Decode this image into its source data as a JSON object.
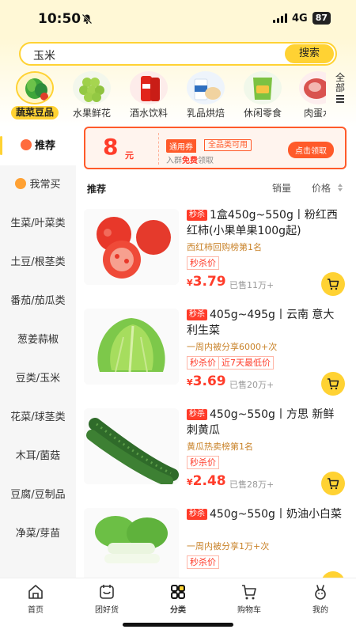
{
  "status": {
    "time": "10:50",
    "network": "4G",
    "battery": "87"
  },
  "search": {
    "query": "玉米",
    "button_label": "搜索"
  },
  "categories": [
    {
      "label": "蔬菜豆品",
      "active": true
    },
    {
      "label": "水果鲜花"
    },
    {
      "label": "酒水饮料"
    },
    {
      "label": "乳品烘焙"
    },
    {
      "label": "休闲零食"
    },
    {
      "label": "肉蛋水"
    }
  ],
  "all_button": {
    "line1": "全",
    "line2": "部"
  },
  "sidebar": [
    {
      "label": "推荐",
      "active": true
    },
    {
      "label": "我常买"
    },
    {
      "label": "生菜/叶菜类"
    },
    {
      "label": "土豆/根茎类"
    },
    {
      "label": "番茄/茄瓜类"
    },
    {
      "label": "葱姜蒜椒"
    },
    {
      "label": "豆类/玉米"
    },
    {
      "label": "花菜/球茎类"
    },
    {
      "label": "木耳/菌菇"
    },
    {
      "label": "豆腐/豆制品"
    },
    {
      "label": "净菜/芽苗"
    }
  ],
  "coupon": {
    "amount": "8",
    "unit": "元",
    "tag_type": "通用券",
    "tag_scope": "全品类可用",
    "sub_prefix": "入群",
    "sub_free": "免费",
    "sub_suffix": "领取",
    "button": "点击领取"
  },
  "sort": {
    "title": "推荐",
    "sales": "销量",
    "price": "价格"
  },
  "products": [
    {
      "badge": "秒杀",
      "title": "1盒450g~550g丨粉红西红柿(小果单果100g起)",
      "rank": "西红柿回购榜第1名",
      "tags": [
        "秒杀价"
      ],
      "yen": "¥",
      "price": "3.79",
      "sold": "已售11万+"
    },
    {
      "badge": "秒杀",
      "title": "405g~495g丨云南 意大利生菜",
      "rank": "一周内被分享6000+次",
      "tags": [
        "秒杀价",
        "近7天最低价"
      ],
      "yen": "¥",
      "price": "3.69",
      "sold": "已售20万+"
    },
    {
      "badge": "秒杀",
      "title": "450g~550g丨方思 新鲜刺黄瓜",
      "rank": "黄瓜热卖榜第1名",
      "tags": [
        "秒杀价"
      ],
      "yen": "¥",
      "price": "2.48",
      "sold": "已售28万+"
    },
    {
      "badge": "秒杀",
      "title": "450g~550g丨奶油小白菜",
      "rank": "一周内被分享1万+次",
      "tags": [
        "秒杀价"
      ]
    }
  ],
  "tabs": [
    {
      "label": "首页"
    },
    {
      "label": "团好货"
    },
    {
      "label": "分类",
      "active": true
    },
    {
      "label": "购物车"
    },
    {
      "label": "我的"
    }
  ],
  "colors": {
    "accent": "#ffd233",
    "price_red": "#ff3c2a",
    "coupon_orange": "#ff5a2a",
    "rank_gold": "#c9832a"
  }
}
